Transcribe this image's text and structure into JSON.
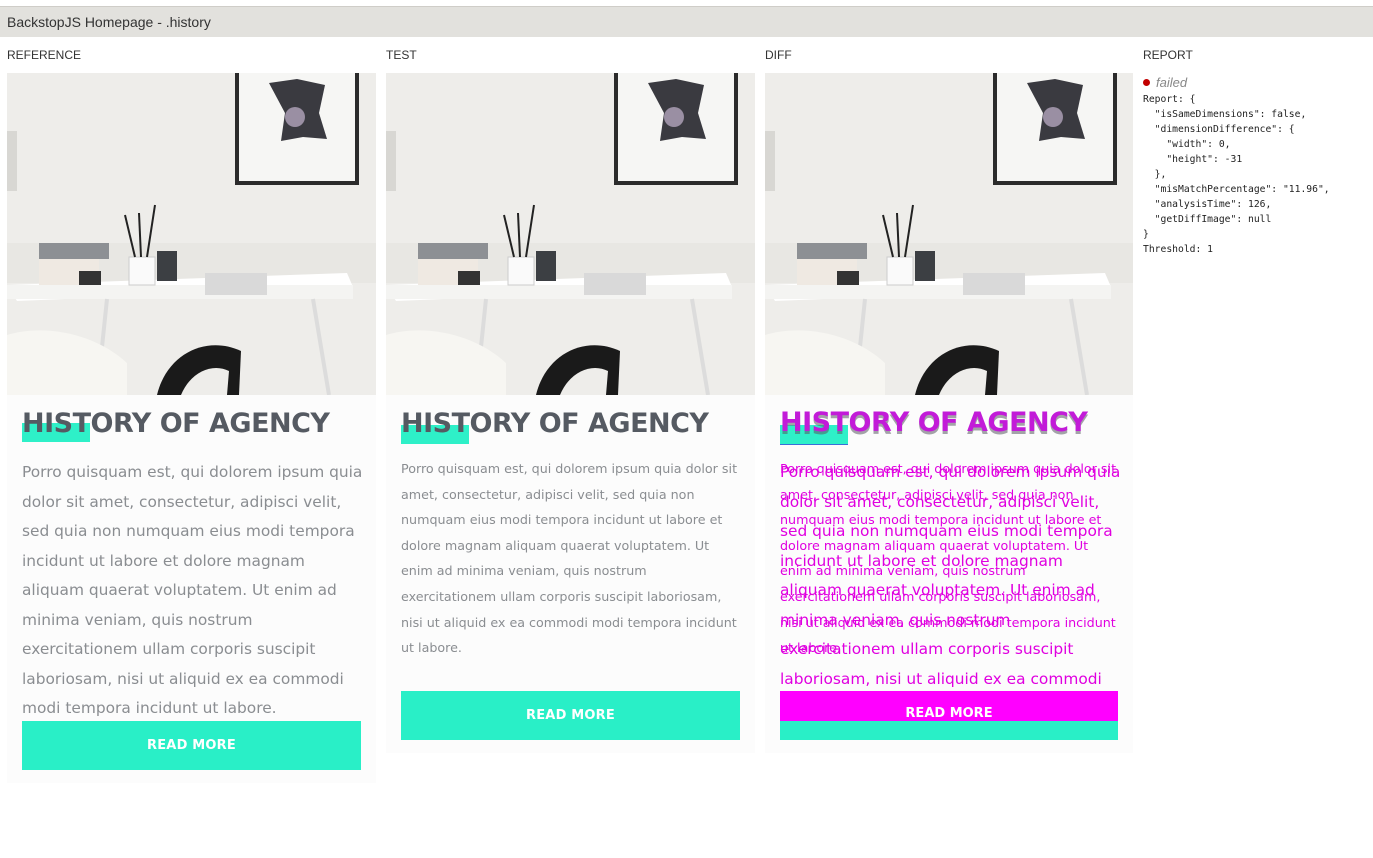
{
  "window": {
    "title": "BackstopJS Homepage - .history"
  },
  "columns": {
    "reference": "REFERENCE",
    "test": "TEST",
    "diff": "DIFF",
    "report": "REPORT"
  },
  "content": {
    "heading": "HISTORY OF AGENCY",
    "paragraph": "Porro quisquam est, qui dolorem ipsum quia dolor sit amet, consectetur, adipisci velit, sed quia non numquam eius modi tempora incidunt ut labore et dolore magnam aliquam quaerat voluptatem. Ut enim ad minima veniam, quis nostrum exercitationem ullam corporis suscipit laboriosam, nisi ut aliquid ex ea commodi modi tempora incidunt ut labore.",
    "button": "READ MORE"
  },
  "report": {
    "status": "failed",
    "json": "Report: {\n  \"isSameDimensions\": false,\n  \"dimensionDifference\": {\n    \"width\": 0,\n    \"height\": -31\n  },\n  \"misMatchPercentage\": \"11.96\",\n  \"analysisTime\": 126,\n  \"getDiffImage\": null\n}\nThreshold: 1"
  },
  "colors": {
    "accent": "#29efc7",
    "diff_highlight": "#ff00ff",
    "failed": "#c20000"
  }
}
